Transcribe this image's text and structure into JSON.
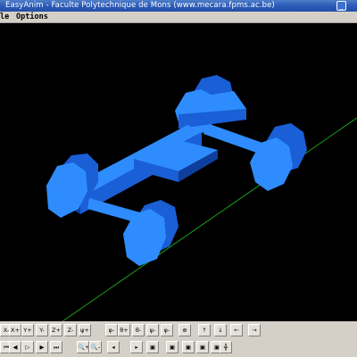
{
  "window": {
    "title": "EasyAnim - Faculte Polytechnique de Mons (www.mecara.fpms.ac.be)"
  },
  "menubar": {
    "items": [
      "le",
      "Options"
    ]
  },
  "toolbar_row1": [
    {
      "name": "rot-x-minus",
      "label": "X-"
    },
    {
      "name": "rot-x-plus",
      "label": "X+"
    },
    {
      "name": "rot-y-plus",
      "label": "Y+"
    },
    {
      "name": "rot-y-minus",
      "label": "Y-"
    },
    {
      "name": "rot-z-plus",
      "label": "Z+"
    },
    {
      "name": "rot-z-minus",
      "label": "Z-"
    },
    {
      "name": "psi-plus",
      "label": "ψ+"
    },
    {
      "name": "phi-plus",
      "label": "φ-"
    },
    {
      "name": "theta-plus",
      "label": "θ+"
    },
    {
      "name": "theta-minus",
      "label": "θ-"
    },
    {
      "name": "psi-minus",
      "label": "ψ-"
    },
    {
      "name": "phi-minus",
      "label": "φ-"
    },
    {
      "name": "center-view",
      "label": "⊕"
    },
    {
      "name": "move-up",
      "label": "↑"
    },
    {
      "name": "move-down",
      "label": "↓"
    },
    {
      "name": "move-left",
      "label": "←"
    },
    {
      "name": "move-right",
      "label": "→"
    }
  ],
  "toolbar_row2": [
    {
      "name": "rewind",
      "label": "⏮"
    },
    {
      "name": "play-back",
      "label": "◀"
    },
    {
      "name": "step-forward",
      "label": "▷"
    },
    {
      "name": "play-forward",
      "label": "▶"
    },
    {
      "name": "fast-forward",
      "label": "⏭"
    },
    {
      "name": "zoom-in",
      "label": "🔍+"
    },
    {
      "name": "zoom-out",
      "label": "🔍-"
    },
    {
      "name": "frame-back",
      "label": "◂"
    },
    {
      "name": "frame-forward",
      "label": "▸"
    },
    {
      "name": "view-1",
      "label": "▣"
    },
    {
      "name": "view-2",
      "label": "▣"
    },
    {
      "name": "view-3",
      "label": "▣"
    },
    {
      "name": "view-4",
      "label": "▣"
    },
    {
      "name": "view-5",
      "label": "▣"
    },
    {
      "name": "axes-toggle",
      "label": "╬"
    }
  ],
  "colors": {
    "model_top": "#2f8cff",
    "model_side": "#1a5fd6",
    "model_dark": "#0e3f9e",
    "axis_line": "#1aa01a",
    "viewport_bg": "#000000"
  }
}
